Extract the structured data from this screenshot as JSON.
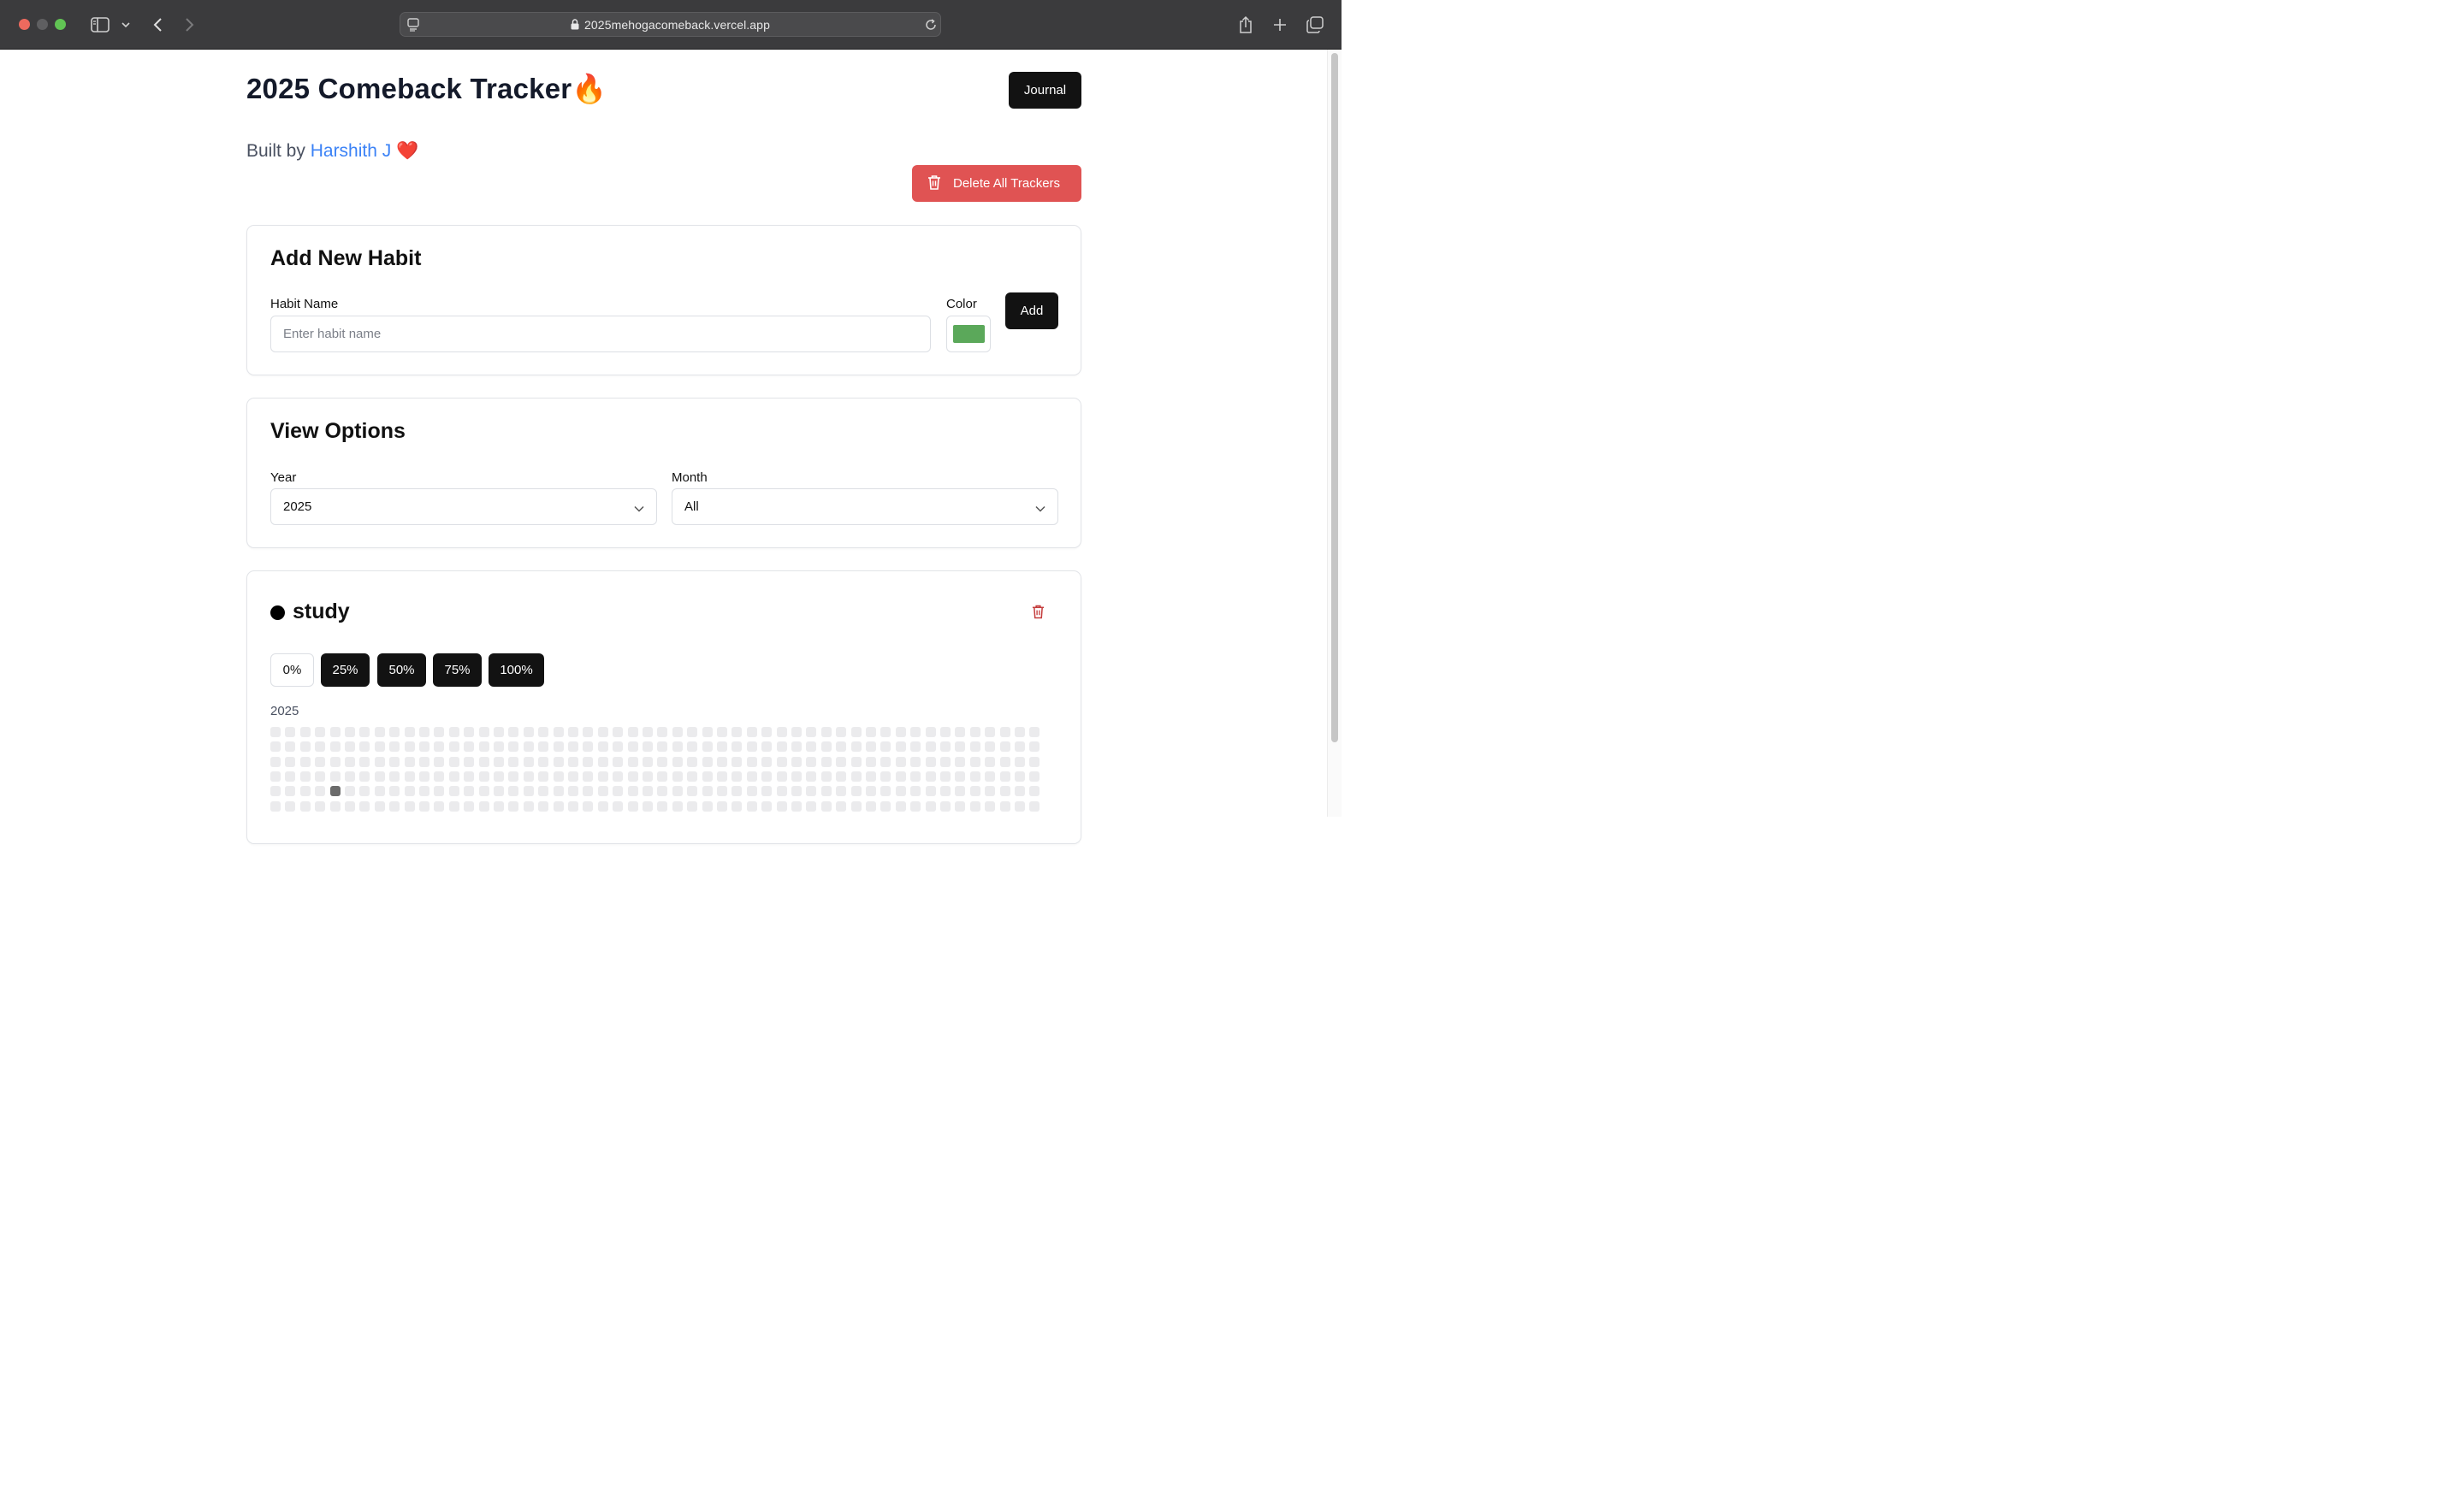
{
  "browser": {
    "url": "2025mehogacomeback.vercel.app",
    "icons": [
      "sidebar-icon",
      "chevron-down-icon",
      "back-icon",
      "forward-icon",
      "page-menu-icon",
      "lock-icon",
      "reload-icon",
      "share-icon",
      "new-tab-icon",
      "tab-overview-icon"
    ]
  },
  "header": {
    "title": "2025 Comeback Tracker🔥",
    "journal_label": "Journal",
    "byline_prefix": "Built by",
    "author": "Harshith J",
    "heart": "❤️",
    "delete_all_label": "Delete All Trackers"
  },
  "add_habit": {
    "heading": "Add New Habit",
    "name_label": "Habit Name",
    "name_placeholder": "Enter habit name",
    "color_label": "Color",
    "color_value": "#5ba85a",
    "add_label": "Add"
  },
  "view_options": {
    "heading": "View Options",
    "year_label": "Year",
    "year_value": "2025",
    "month_label": "Month",
    "month_value": "All"
  },
  "habit": {
    "name": "study",
    "dot_color": "#000000",
    "percent_options": [
      {
        "label": "0%",
        "selected": false
      },
      {
        "label": "25%",
        "selected": true
      },
      {
        "label": "50%",
        "selected": true
      },
      {
        "label": "75%",
        "selected": true
      },
      {
        "label": "100%",
        "selected": true
      }
    ],
    "year_label": "2025",
    "grid": {
      "columns": 52,
      "visible_rows": 6,
      "filled": [
        {
          "col": 4,
          "row": 4
        }
      ]
    }
  },
  "colors": {
    "accent_dark": "#121212",
    "danger": "#e05353",
    "link": "#3b82f6",
    "empty_cell": "#ebebed",
    "filled_cell": "#6b6b6b"
  }
}
